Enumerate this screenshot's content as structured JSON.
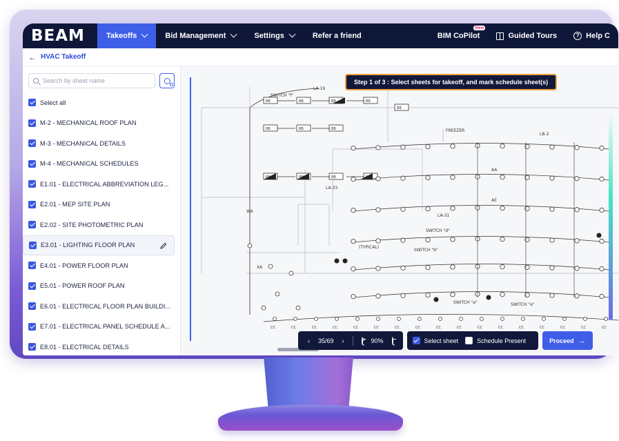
{
  "app": {
    "logo_main": "BEAM",
    "brand_color": "#3f5ee8"
  },
  "nav": {
    "items": [
      {
        "label": "Takeoffs",
        "active": true,
        "dropdown": true
      },
      {
        "label": "Bid Management",
        "active": false,
        "dropdown": true
      },
      {
        "label": "Settings",
        "active": false,
        "dropdown": true
      },
      {
        "label": "Refer a friend",
        "active": false,
        "dropdown": false
      }
    ],
    "right": {
      "copilot": "BIM CoPilot",
      "copilot_badge": "New",
      "tours": "Guided Tours",
      "help": "Help C"
    }
  },
  "breadcrumb": {
    "back_icon": "arrow-left-icon",
    "label": "HVAC Takeoff"
  },
  "sidebar": {
    "search_placeholder": "Search by sheet name",
    "select_all": "Select all",
    "sheets": [
      {
        "label": "M-2 - MECHANICAL ROOF PLAN",
        "checked": true
      },
      {
        "label": "M-3 - MECHANICAL DETAILS",
        "checked": true
      },
      {
        "label": "M-4 - MECHANICAL SCHEDULES",
        "checked": true
      },
      {
        "label": "E1.01 - ELECTRICAL ABBREVIATION LEG...",
        "checked": true
      },
      {
        "label": "E2.01 - MEP SITE PLAN",
        "checked": true
      },
      {
        "label": "E2.02 - SITE PHOTOMETRIC PLAN",
        "checked": true
      },
      {
        "label": "E3.01 - LIGHTING FLOOR PLAN",
        "checked": true,
        "selected": true
      },
      {
        "label": "E4.01 - POWER FLOOR PLAN",
        "checked": true
      },
      {
        "label": "E5.01 - POWER ROOF PLAN",
        "checked": true
      },
      {
        "label": "E6.01 - ELECTRICAL FLOOR PLAN BUILDI...",
        "checked": true
      },
      {
        "label": "E7.01 - ELECTRICAL PANEL SCHEDULE A...",
        "checked": true
      },
      {
        "label": "E8.01 - ELECTRICAL DETAILS",
        "checked": true
      }
    ]
  },
  "banner": {
    "text": "Step 1 of 3 :  Select sheets for takeoff, and mark schedule sheet(s)"
  },
  "toolbar": {
    "page": "35/69",
    "zoom": "90%",
    "select_sheet": "Select sheet",
    "select_sheet_checked": true,
    "schedule_present": "Schedule Present",
    "schedule_present_checked": false,
    "proceed": "Proceed"
  },
  "drawing": {
    "labels": [
      "SWITCH \"f\"",
      "LA-19",
      "LA-33",
      "LB-2",
      "SWITCH \"d\"",
      "LA-31",
      "SWITCH \"b\"",
      "SWITCH \"a\"",
      "SWITCH \"e\"",
      "(TYPICAL)",
      "FREEZER",
      "BB",
      "AA",
      "AE",
      "CC",
      "WA",
      "XA"
    ]
  }
}
